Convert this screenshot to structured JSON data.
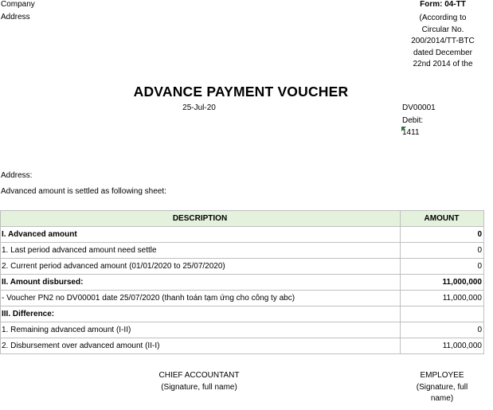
{
  "header": {
    "company_label": "Company",
    "address_label": "Address",
    "form_code": "Form: 04-TT",
    "form_note_lines": [
      "(According to",
      "Circular No.",
      "200/2014/TT-BTC",
      "dated December",
      "22nd 2014 of the"
    ]
  },
  "document": {
    "title": "ADVANCE PAYMENT VOUCHER",
    "date": "25-Jul-20",
    "voucher_no": "DV00001",
    "debit_label": "Debit:",
    "debit_value": "1411",
    "address_label": "Address:",
    "settle_text": "Advanced amount is settled as following sheet:"
  },
  "table": {
    "headers": [
      "DESCRIPTION",
      "AMOUNT"
    ],
    "rows": [
      {
        "description": "I. Advanced amount",
        "amount": "0",
        "bold": true
      },
      {
        "description": "1. Last period advanced amount need settle",
        "amount": "0",
        "bold": false
      },
      {
        "description": "2. Current period advanced amount (01/01/2020 to 25/07/2020)",
        "amount": "0",
        "bold": false
      },
      {
        "description": "II. Amount disbursed:",
        "amount": "11,000,000",
        "bold": true
      },
      {
        "description": "- Voucher PN2 no DV00001 date 25/07/2020 (thanh toán tạm ứng cho công ty abc)",
        "amount": "11,000,000",
        "bold": false
      },
      {
        "description": "III. Difference:",
        "amount": "",
        "bold": true
      },
      {
        "description": "1. Remaining advanced amount (I-II)",
        "amount": "0",
        "bold": false
      },
      {
        "description": "2. Disbursement over advanced amount (II-I)",
        "amount": "11,000,000",
        "bold": false
      }
    ]
  },
  "signatures": {
    "chief_accountant": {
      "title": "CHIEF ACCOUNTANT",
      "note": "(Signature, full name)"
    },
    "employee": {
      "title": "EMPLOYEE",
      "note_lines": [
        "(Signature, full",
        "name)"
      ]
    }
  },
  "colors": {
    "header_fill": "#e3f1dd",
    "grid_border": "#bfbfbf",
    "cell_marker": "#1f7a3a"
  }
}
